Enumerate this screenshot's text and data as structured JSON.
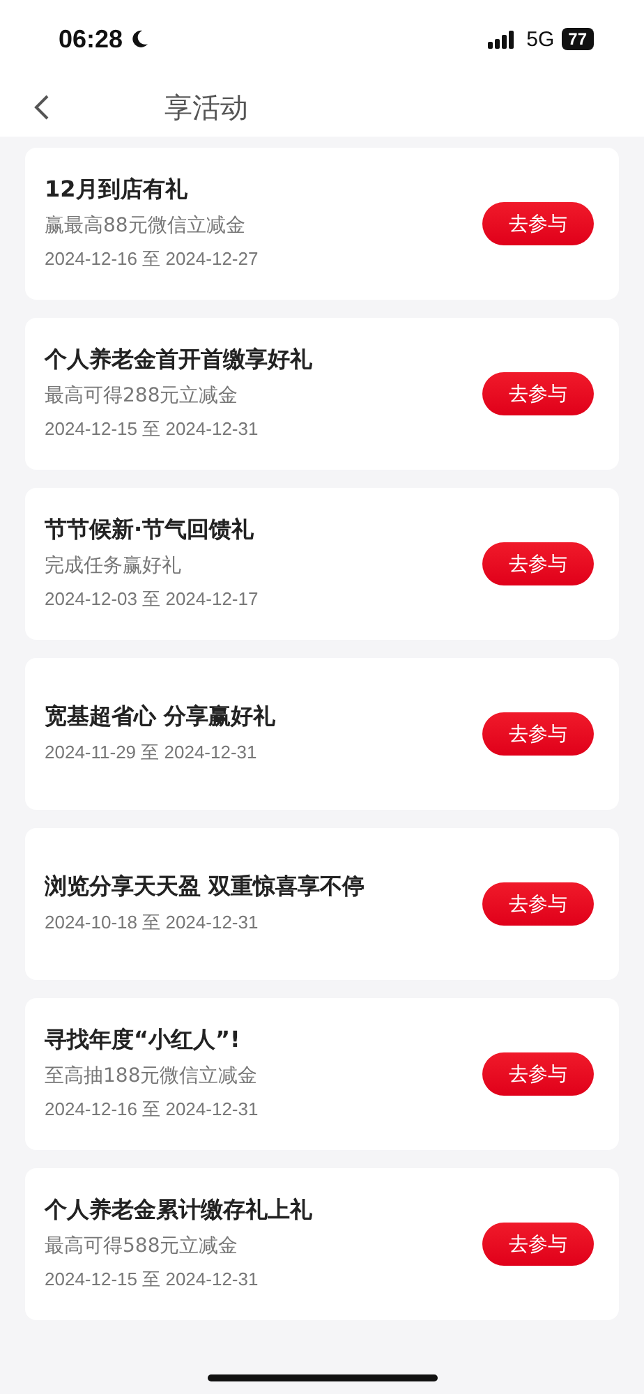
{
  "status_bar": {
    "time": "06:28",
    "network": "5G",
    "battery": "77"
  },
  "header": {
    "title": "享活动"
  },
  "activities": [
    {
      "title": "12月到店有礼",
      "subtitle": "赢最高88元微信立减金",
      "dates": "2024-12-16 至 2024-12-27",
      "button": "去参与"
    },
    {
      "title": "个人养老金首开首缴享好礼",
      "subtitle": "最高可得288元立减金",
      "dates": "2024-12-15 至 2024-12-31",
      "button": "去参与"
    },
    {
      "title": "节节候新·节气回馈礼",
      "subtitle": "完成任务赢好礼",
      "dates": "2024-12-03 至 2024-12-17",
      "button": "去参与"
    },
    {
      "title": "宽基超省心 分享赢好礼",
      "dates": "2024-11-29 至 2024-12-31",
      "button": "去参与"
    },
    {
      "title": "浏览分享天天盈 双重惊喜享不停",
      "dates": "2024-10-18 至 2024-12-31",
      "button": "去参与"
    },
    {
      "title": "寻找年度“小红人”!",
      "subtitle": "至高抽188元微信立减金",
      "dates": "2024-12-16 至 2024-12-31",
      "button": "去参与"
    },
    {
      "title": "个人养老金累计缴存礼上礼",
      "subtitle": "最高可得588元立减金",
      "dates": "2024-12-15 至 2024-12-31",
      "button": "去参与"
    }
  ]
}
